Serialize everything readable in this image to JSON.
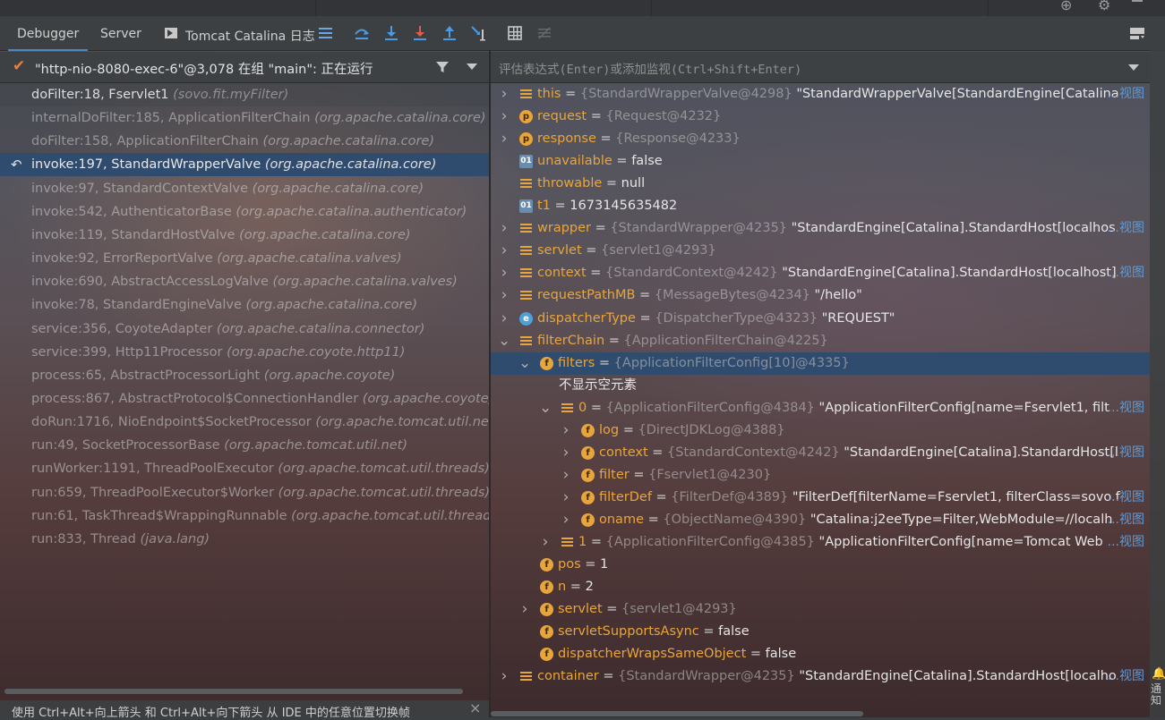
{
  "tabs": {
    "debugger": "Debugger",
    "server": "Server",
    "tomcat_log": "Tomcat Catalina 日志"
  },
  "thread": {
    "label": "\"http-nio-8080-exec-6\"@3,078 在组 \"main\": 正在运行"
  },
  "eval": {
    "placeholder": "评估表达式(Enter)或添加监视(Ctrl+Shift+Enter)"
  },
  "frames": [
    {
      "method": "doFilter:18, Fservlet1",
      "pkg": "(sovo.fit.myFilter)",
      "state": "current"
    },
    {
      "method": "internalDoFilter:185, ApplicationFilterChain",
      "pkg": "(org.apache.catalina.core)",
      "state": "dim"
    },
    {
      "method": "doFilter:158, ApplicationFilterChain",
      "pkg": "(org.apache.catalina.core)",
      "state": "dim"
    },
    {
      "method": "invoke:197, StandardWrapperValve",
      "pkg": "(org.apache.catalina.core)",
      "state": "selected"
    },
    {
      "method": "invoke:97, StandardContextValve",
      "pkg": "(org.apache.catalina.core)",
      "state": ""
    },
    {
      "method": "invoke:542, AuthenticatorBase",
      "pkg": "(org.apache.catalina.authenticator)",
      "state": ""
    },
    {
      "method": "invoke:119, StandardHostValve",
      "pkg": "(org.apache.catalina.core)",
      "state": ""
    },
    {
      "method": "invoke:92, ErrorReportValve",
      "pkg": "(org.apache.catalina.valves)",
      "state": ""
    },
    {
      "method": "invoke:690, AbstractAccessLogValve",
      "pkg": "(org.apache.catalina.valves)",
      "state": ""
    },
    {
      "method": "invoke:78, StandardEngineValve",
      "pkg": "(org.apache.catalina.core)",
      "state": ""
    },
    {
      "method": "service:356, CoyoteAdapter",
      "pkg": "(org.apache.catalina.connector)",
      "state": ""
    },
    {
      "method": "service:399, Http11Processor",
      "pkg": "(org.apache.coyote.http11)",
      "state": ""
    },
    {
      "method": "process:65, AbstractProcessorLight",
      "pkg": "(org.apache.coyote)",
      "state": ""
    },
    {
      "method": "process:867, AbstractProtocol$ConnectionHandler",
      "pkg": "(org.apache.coyote)",
      "state": ""
    },
    {
      "method": "doRun:1716, NioEndpoint$SocketProcessor",
      "pkg": "(org.apache.tomcat.util.net)",
      "state": ""
    },
    {
      "method": "run:49, SocketProcessorBase",
      "pkg": "(org.apache.tomcat.util.net)",
      "state": ""
    },
    {
      "method": "runWorker:1191, ThreadPoolExecutor",
      "pkg": "(org.apache.tomcat.util.threads)",
      "state": ""
    },
    {
      "method": "run:659, ThreadPoolExecutor$Worker",
      "pkg": "(org.apache.tomcat.util.threads)",
      "state": ""
    },
    {
      "method": "run:61, TaskThread$WrappingRunnable",
      "pkg": "(org.apache.tomcat.util.threads)",
      "state": ""
    },
    {
      "method": "run:833, Thread",
      "pkg": "(java.lang)",
      "state": ""
    }
  ],
  "variables": [
    {
      "name": "this",
      "type": "{StandardWrapperValve@4298}",
      "value": "\"StandardWrapperValve[StandardEngine[Catalina",
      "link": "...视图",
      "icon": "list",
      "arrow": "▶",
      "indent": 0,
      "selected": false
    },
    {
      "name": "request",
      "type": "{Request@4232}",
      "value": "",
      "link": "",
      "icon": "p",
      "arrow": "▶",
      "indent": 0,
      "selected": false
    },
    {
      "name": "response",
      "type": "{Response@4233}",
      "value": "",
      "link": "",
      "icon": "p",
      "arrow": "▶",
      "indent": 0,
      "selected": false
    },
    {
      "name": "unavailable",
      "type": "",
      "value": "false",
      "link": "",
      "icon": "ol",
      "arrow": "",
      "indent": 0,
      "selected": false
    },
    {
      "name": "throwable",
      "type": "",
      "value": "null",
      "link": "",
      "icon": "list",
      "arrow": "",
      "indent": 0,
      "selected": false
    },
    {
      "name": "t1",
      "type": "",
      "value": "1673145635482",
      "link": "",
      "icon": "ol",
      "arrow": "",
      "indent": 0,
      "selected": false
    },
    {
      "name": "wrapper",
      "type": "{StandardWrapper@4235}",
      "value": "\"StandardEngine[Catalina].StandardHost[localhos",
      "link": "...视图",
      "icon": "list",
      "arrow": "▶",
      "indent": 0,
      "selected": false
    },
    {
      "name": "servlet",
      "type": "{servlet1@4293}",
      "value": "",
      "link": "",
      "icon": "list",
      "arrow": "▶",
      "indent": 0,
      "selected": false
    },
    {
      "name": "context",
      "type": "{StandardContext@4242}",
      "value": "\"StandardEngine[Catalina].StandardHost[localhost]",
      "link": "...视图",
      "icon": "list",
      "arrow": "▶",
      "indent": 0,
      "selected": false
    },
    {
      "name": "requestPathMB",
      "type": "{MessageBytes@4234}",
      "value": "\"/hello\"",
      "link": "",
      "icon": "list",
      "arrow": "▶",
      "indent": 0,
      "selected": false
    },
    {
      "name": "dispatcherType",
      "type": "{DispatcherType@4323}",
      "value": "\"REQUEST\"",
      "link": "",
      "icon": "e",
      "arrow": "▶",
      "indent": 0,
      "selected": false
    },
    {
      "name": "filterChain",
      "type": "{ApplicationFilterChain@4225}",
      "value": "",
      "link": "",
      "icon": "list",
      "arrow": "▼",
      "indent": 0,
      "selected": false
    },
    {
      "name": "filters",
      "type": "{ApplicationFilterConfig[10]@4335}",
      "value": "",
      "link": "",
      "icon": "f",
      "arrow": "▼",
      "indent": 1,
      "selected": true
    },
    {
      "name": "",
      "type": "",
      "value": "不显示空元素",
      "link": "",
      "icon": "none",
      "arrow": "",
      "indent": 1,
      "selected": false
    },
    {
      "name": "0",
      "type": "{ApplicationFilterConfig@4384}",
      "value": "\"ApplicationFilterConfig[name=Fservlet1, filt",
      "link": "...视图",
      "icon": "list",
      "arrow": "▼",
      "indent": 2,
      "selected": false
    },
    {
      "name": "log",
      "type": "{DirectJDKLog@4388}",
      "value": "",
      "link": "",
      "icon": "f",
      "arrow": "▶",
      "indent": 3,
      "selected": false
    },
    {
      "name": "context",
      "type": "{StandardContext@4242}",
      "value": "\"StandardEngine[Catalina].StandardHost[l",
      "link": "...视图",
      "icon": "f",
      "arrow": "▶",
      "indent": 3,
      "selected": false
    },
    {
      "name": "filter",
      "type": "{Fservlet1@4230}",
      "value": "",
      "link": "",
      "icon": "f",
      "arrow": "▶",
      "indent": 3,
      "selected": false
    },
    {
      "name": "filterDef",
      "type": "{FilterDef@4389}",
      "value": "\"FilterDef[filterName=Fservlet1, filterClass=sovo.f",
      "link": "...视图",
      "icon": "f",
      "arrow": "▶",
      "indent": 3,
      "selected": false
    },
    {
      "name": "oname",
      "type": "{ObjectName@4390}",
      "value": "\"Catalina:j2eeType=Filter,WebModule=//localh",
      "link": "...视图",
      "icon": "f",
      "arrow": "▶",
      "indent": 3,
      "selected": false
    },
    {
      "name": "1",
      "type": "{ApplicationFilterConfig@4385}",
      "value": "\"ApplicationFilterConfig[name=Tomcat Web",
      "link": "...视图",
      "icon": "list",
      "arrow": "▶",
      "indent": 2,
      "selected": false
    },
    {
      "name": "pos",
      "type": "",
      "value": "1",
      "link": "",
      "icon": "f",
      "arrow": "",
      "indent": 1,
      "selected": false
    },
    {
      "name": "n",
      "type": "",
      "value": "2",
      "link": "",
      "icon": "f",
      "arrow": "",
      "indent": 1,
      "selected": false
    },
    {
      "name": "servlet",
      "type": "{servlet1@4293}",
      "value": "",
      "link": "",
      "icon": "f",
      "arrow": "▶",
      "indent": 1,
      "selected": false
    },
    {
      "name": "servletSupportsAsync",
      "type": "",
      "value": "false",
      "link": "",
      "icon": "f",
      "arrow": "",
      "indent": 1,
      "selected": false
    },
    {
      "name": "dispatcherWrapsSameObject",
      "type": "",
      "value": "false",
      "link": "",
      "icon": "f",
      "arrow": "",
      "indent": 1,
      "selected": false
    },
    {
      "name": "container",
      "type": "{StandardWrapper@4235}",
      "value": "\"StandardEngine[Catalina].StandardHost[localho",
      "link": "...视图",
      "icon": "list",
      "arrow": "▶",
      "indent": 0,
      "selected": false
    }
  ],
  "status": {
    "hint": "使用 Ctrl+Alt+向上箭头 和 Ctrl+Alt+向下箭头 从 IDE 中的任意位置切换帧",
    "close": "×"
  },
  "right_strip": {
    "label": "通知"
  },
  "colors": {
    "accent": "#4a88c7",
    "selection": "#2f4b6e",
    "var_name": "#e8a53c",
    "link": "#5f9bd8"
  }
}
